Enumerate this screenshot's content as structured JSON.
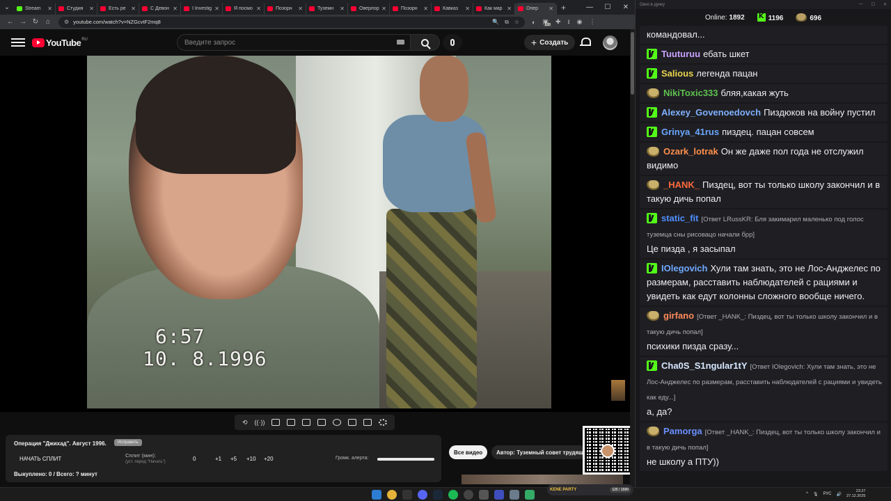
{
  "browser": {
    "tabs": [
      {
        "title": "Stream",
        "fav": "k",
        "active": false
      },
      {
        "title": "Студия",
        "fav": "yt",
        "active": false
      },
      {
        "title": "Есть ре",
        "fav": "yt",
        "active": false
      },
      {
        "title": "С Девон",
        "fav": "yt",
        "active": false
      },
      {
        "title": "I Investig",
        "fav": "yt",
        "active": false
      },
      {
        "title": "Я посмо",
        "fav": "yt",
        "active": false
      },
      {
        "title": "Позорн",
        "fav": "yt",
        "active": false
      },
      {
        "title": "Туземн",
        "fav": "yt",
        "active": false
      },
      {
        "title": "Оверлор",
        "fav": "yt",
        "active": false
      },
      {
        "title": "Позорн",
        "fav": "yt",
        "active": false
      },
      {
        "title": "Кавказ",
        "fav": "yt",
        "active": false
      },
      {
        "title": "Как мар",
        "fav": "yt",
        "active": false
      },
      {
        "title": "Опер",
        "fav": "yt",
        "active": true
      }
    ],
    "url": "youtube.com/watch?v=NZGcvtF2mq8",
    "ext_badge": "520"
  },
  "youtube": {
    "logo_text": "YouTube",
    "region": "RU",
    "search_placeholder": "Введите запрос",
    "create_label": "Создать",
    "video": {
      "timecode_time": "6:57",
      "timecode_date": "10. 8.1996"
    }
  },
  "panel": {
    "title": "Операция \"Джихад\". Август 1996.",
    "tag": "Исправить",
    "start_split": "НАЧАТЬ СПЛИТ",
    "split_label": "Сплит (мин):",
    "split_sub": "(уст. перед \"Начать\")",
    "split_values": [
      "0",
      "+1",
      "+5",
      "+10",
      "+20"
    ],
    "volume_label": "Громк. алерта:",
    "volume_level": 1.0,
    "status": "Выкуплено: 0 / Всего: ? минут",
    "all_videos": "Все видео",
    "author": "Автор: Туземный совет трудящихся"
  },
  "chat": {
    "window_title": "Окно в дунку",
    "online_label": "Online:",
    "online_count": "1892",
    "kick_count": "1196",
    "other_count": "696",
    "messages": [
      {
        "badge": "none",
        "user": "",
        "color": "#efeff1",
        "reply": "",
        "text": "командовал..."
      },
      {
        "badge": "k",
        "user": "Tuuturuu",
        "color": "#c9a0ff",
        "reply": "",
        "text": "ебать шкет"
      },
      {
        "badge": "k",
        "user": "Salious",
        "color": "#e8d44d",
        "reply": "",
        "text": "легенда пацан"
      },
      {
        "badge": "p",
        "user": "NikiToxic333",
        "color": "#5fc24f",
        "reply": "",
        "text": "бляя,какая жуть"
      },
      {
        "badge": "k",
        "user": "Alexey_Govenoedovch",
        "color": "#7fb0ff",
        "reply": "",
        "text": "Пиздюков на войну пустил"
      },
      {
        "badge": "k",
        "user": "Grinya_41rus",
        "color": "#6aa7ff",
        "reply": "",
        "text": "пиздец. пацан совсем"
      },
      {
        "badge": "p",
        "user": "Ozark_lotrak",
        "color": "#ff8f4d",
        "reply": "",
        "text": "Он же даже пол года не отслужил видимо"
      },
      {
        "badge": "p",
        "user": "_HANK_",
        "color": "#ff6a3d",
        "reply": "",
        "text": "Пиздец, вот ты только школу закончил и в такую дичь попал"
      },
      {
        "badge": "k",
        "user": "static_fit",
        "color": "#4f8fff",
        "reply": "[Ответ LRussKR: Бля закимарил маленько под голос туземца сны рисовацо начали брр]",
        "text": "Це пизда , я засыпал"
      },
      {
        "badge": "k",
        "user": "IOlegovich",
        "color": "#6fa8ff",
        "reply": "",
        "text": "Хули там знать, это не Лос-Анджелес по размерам, расставить наблюдателей с рациями и увидеть как едут колонны сложного вообще ничего."
      },
      {
        "badge": "p",
        "user": "girfano",
        "color": "#ff8a5c",
        "reply": "[Ответ _HANK_: Пиздец, вот ты только школу закончил и в такую дичь попал]",
        "text": "психики пизда сразу..."
      },
      {
        "badge": "k",
        "user": "Cha0S_S1ngular1tY",
        "color": "#d7e7ff",
        "reply": "[Ответ IOlegovich: Хули там знать, это не Лос-Анджелес по размерам, расставить наблюдателей с рациями и увидеть как еду...]",
        "text": "а, да?"
      },
      {
        "badge": "p",
        "user": "Pamorga",
        "color": "#6a8fff",
        "reply": "[Ответ _HANK_: Пиздец, вот ты только школу закончил и в такую дичь попал]",
        "text": "не школу а ПТУ))"
      }
    ]
  },
  "taskbar": {
    "kparty_label": "KENE PARTY",
    "kparty_count": "125 / 1590",
    "lang": "РУС",
    "time": "23:27",
    "date": "27.12.2025"
  }
}
